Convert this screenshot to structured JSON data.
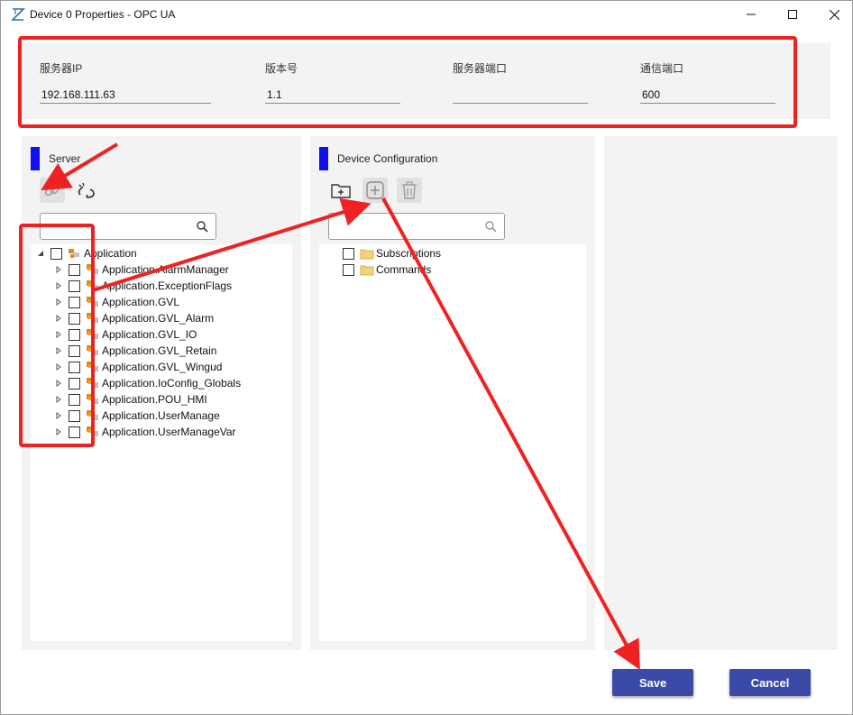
{
  "window": {
    "title": "Device 0 Properties - OPC UA",
    "controls": [
      "minimize-icon",
      "maximize-icon",
      "close-icon"
    ]
  },
  "connection": {
    "server_ip": {
      "label": "服务器IP",
      "value": "192.168.111.63"
    },
    "version": {
      "label": "版本号",
      "value": "1.1"
    },
    "server_port": {
      "label": "服务器端口",
      "value": ""
    },
    "comm_port": {
      "label": "通信端口",
      "value": "600"
    }
  },
  "server": {
    "title": "Server",
    "tools": [
      "link-icon",
      "unlink-icon"
    ],
    "search": {
      "placeholder": "",
      "value": ""
    },
    "root": {
      "label": "Application",
      "expanded": true,
      "checked": false
    },
    "items": [
      {
        "label": "Application.AlarmManager",
        "checked": false
      },
      {
        "label": "Application.ExceptionFlags",
        "checked": false
      },
      {
        "label": "Application.GVL",
        "checked": false
      },
      {
        "label": "Application.GVL_Alarm",
        "checked": false
      },
      {
        "label": "Application.GVL_IO",
        "checked": false
      },
      {
        "label": "Application.GVL_Retain",
        "checked": false
      },
      {
        "label": "Application.GVL_Wingud",
        "checked": false
      },
      {
        "label": "Application.IoConfig_Globals",
        "checked": false
      },
      {
        "label": "Application.POU_HMI",
        "checked": false
      },
      {
        "label": "Application.UserManage",
        "checked": false
      },
      {
        "label": "Application.UserManageVar",
        "checked": false
      }
    ]
  },
  "device_config": {
    "title": "Device Configuration",
    "tools": [
      "add-folder-icon",
      "add-icon",
      "delete-icon"
    ],
    "search": {
      "placeholder": "",
      "value": ""
    },
    "items": [
      {
        "label": "Subscriptions",
        "checked": false
      },
      {
        "label": "Commands",
        "checked": false
      }
    ]
  },
  "buttons": {
    "save": "Save",
    "cancel": "Cancel"
  },
  "colors": {
    "accent_bar": "#1010ee",
    "button_bg": "#3b4aa6",
    "annotation_red": "#ee2222",
    "panel_bg": "#f3f3f3"
  }
}
